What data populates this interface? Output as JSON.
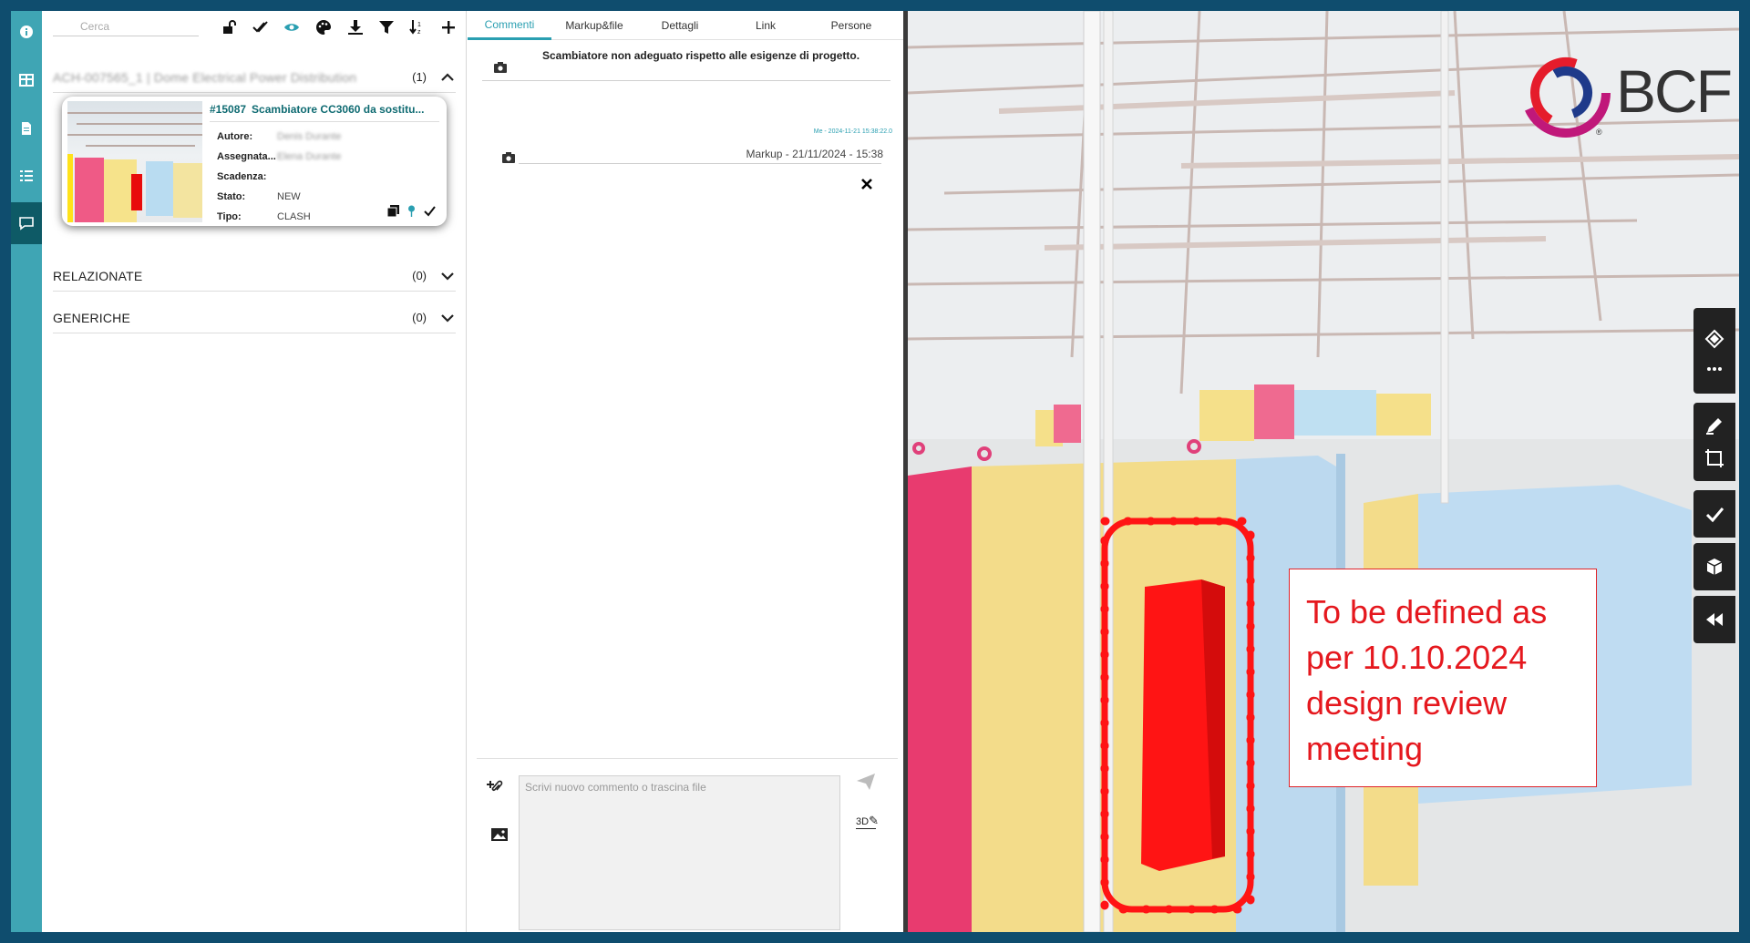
{
  "left_panel": {
    "search_placeholder": "Cerca",
    "toolbar_icons": [
      "unlock-icon",
      "double-check-icon",
      "eye-icon",
      "palette-icon",
      "download-icon",
      "filter-icon",
      "sort-icon",
      "plus-icon"
    ],
    "groups": [
      {
        "title": "ACH-007565_1 | Dome Electrical Power Distribution",
        "count": "(1)",
        "expanded": true
      },
      {
        "title": "RELAZIONATE",
        "count": "(0)",
        "expanded": false
      },
      {
        "title": "GENERICHE",
        "count": "(0)",
        "expanded": false
      }
    ],
    "issue_card": {
      "id": "#15087",
      "title": "Scambiatore CC3060 da sostitu...",
      "fields": [
        {
          "key": "Autore:",
          "value": "Denis Durante",
          "blurred": true
        },
        {
          "key": "Assegnata...",
          "value": "Elena Durante",
          "blurred": true
        },
        {
          "key": "Scadenza:",
          "value": "",
          "blurred": false
        },
        {
          "key": "Stato:",
          "value": "NEW",
          "blurred": false
        },
        {
          "key": "Tipo:",
          "value": "CLASH",
          "blurred": false
        }
      ]
    }
  },
  "middle_panel": {
    "tabs": [
      "Commenti",
      "Markup&file",
      "Dettagli",
      "Link",
      "Persone"
    ],
    "active_tab": "Commenti",
    "comments": [
      {
        "text": "Scambiatore non adeguato rispetto alle esigenze di progetto."
      },
      {
        "meta": "Me - 2024-11-21 15:38:22.0",
        "text": "Markup - 21/11/2024 - 15:38"
      }
    ],
    "composer_placeholder": "Scrivi nuovo commento o trascina file",
    "composer_3d_label": "3D"
  },
  "viewer": {
    "logo_text": "BCF",
    "logo_reg": "®",
    "note_text": "To be defined as per 10.10.2024 design review meeting",
    "accent_red": "#e5181e",
    "right_tools": [
      "isolate-icon",
      "more-icon",
      "markup-pen-icon",
      "section-box-icon",
      "check-icon",
      "cube-icon",
      "rewind-icon"
    ]
  },
  "colors": {
    "frame": "#0f4d6e",
    "rail": "#3fa5b4",
    "accent": "#2a9fb1"
  }
}
